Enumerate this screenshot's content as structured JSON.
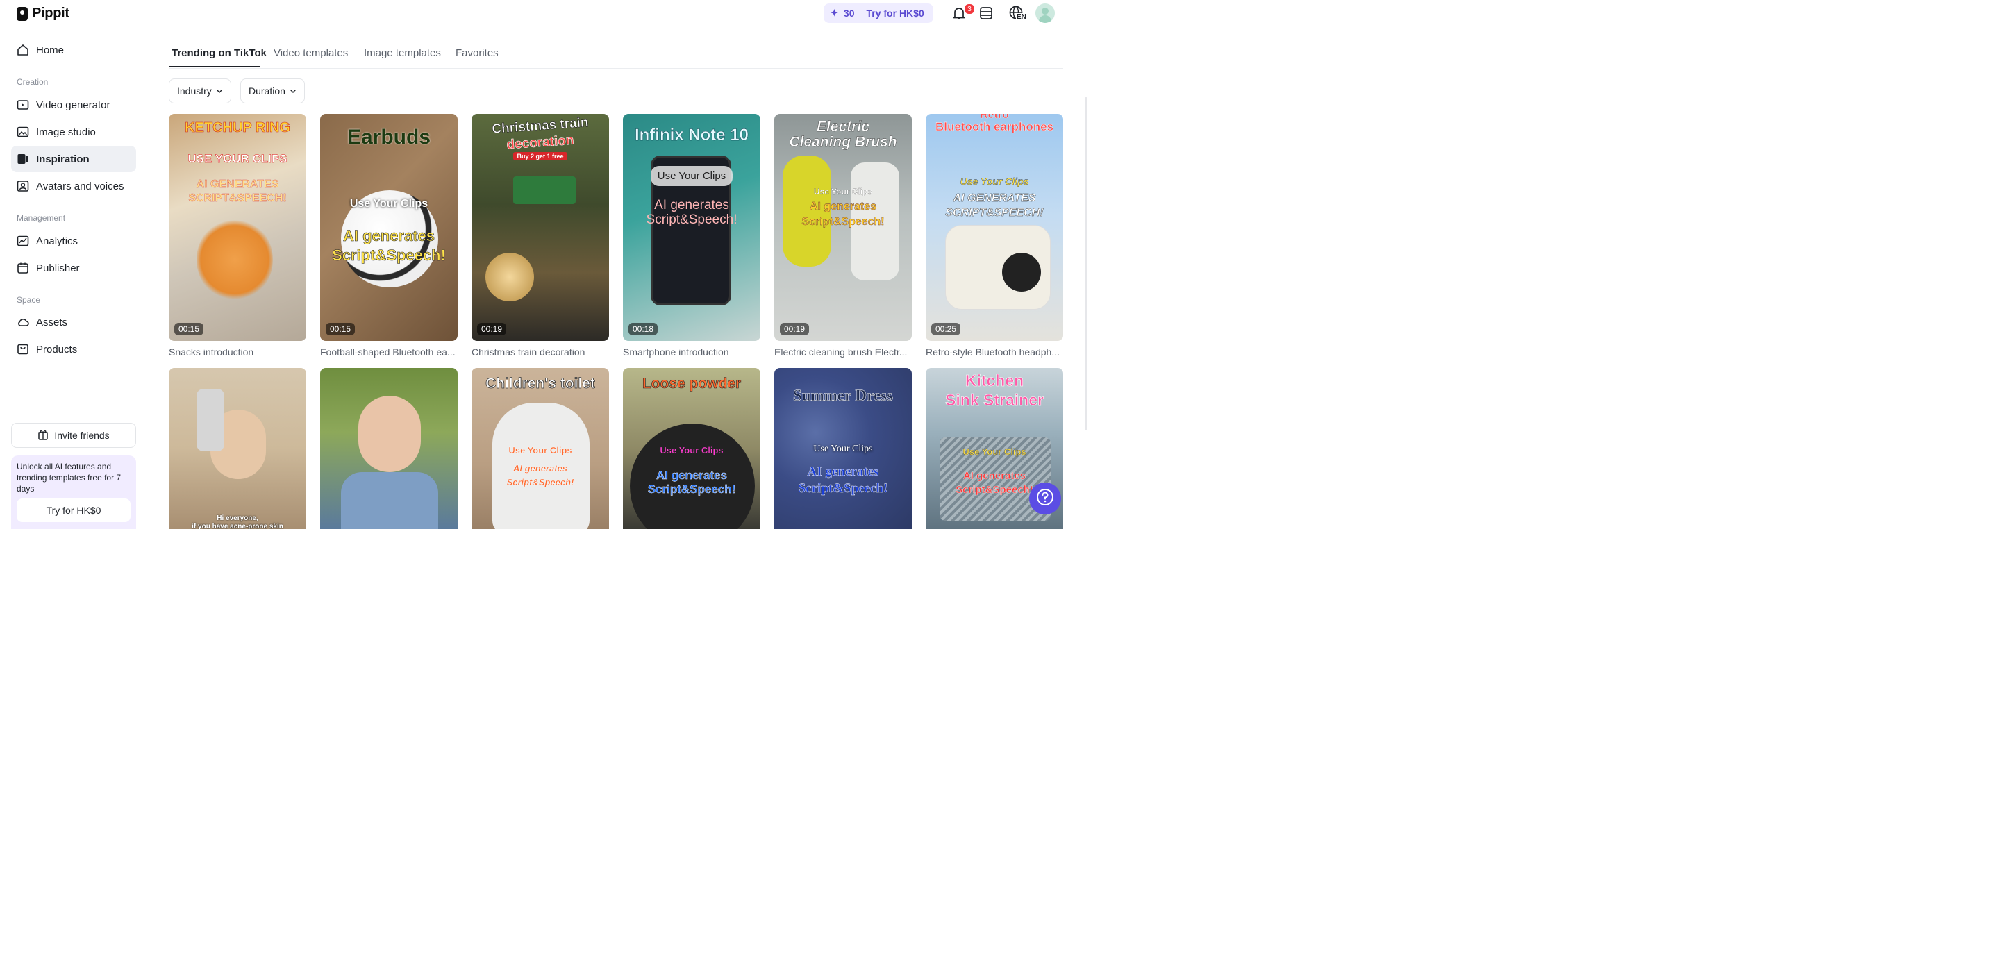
{
  "app": {
    "name": "Pippit"
  },
  "sidebar": {
    "home": "Home",
    "sections": {
      "creation": "Creation",
      "management": "Management",
      "space": "Space"
    },
    "creation_items": [
      "Video generator",
      "Image studio",
      "Inspiration",
      "Avatars and voices"
    ],
    "management_items": [
      "Analytics",
      "Publisher"
    ],
    "space_items": [
      "Assets",
      "Products"
    ],
    "active_item": "Inspiration",
    "invite_label": "Invite friends",
    "promo": {
      "text": "Unlock all AI features and trending templates free for 7 days",
      "button": "Try for HK$0"
    }
  },
  "header": {
    "credits": "30",
    "try_label": "Try for HK$0",
    "notification_count": "3",
    "language": "EN"
  },
  "tabs": [
    "Trending on TikTok",
    "Video templates",
    "Image templates",
    "Favorites"
  ],
  "active_tab": "Trending on TikTok",
  "filters": [
    "Industry",
    "Duration"
  ],
  "row1": [
    {
      "duration": "00:15",
      "caption": "Snacks introduction",
      "overlay": [
        "KETCHUP RING",
        "USE YOUR CLIPS",
        "AI GENERATES",
        "SCRIPT&SPEECH!"
      ]
    },
    {
      "duration": "00:15",
      "caption": "Football-shaped Bluetooth ea...",
      "overlay": [
        "Earbuds",
        "Use Your Clips",
        "AI generates",
        "Script&Speech!"
      ]
    },
    {
      "duration": "00:19",
      "caption": "Christmas train decoration",
      "overlay": [
        "Christmas train",
        "decoration",
        "Buy 2 get 1 free"
      ]
    },
    {
      "duration": "00:18",
      "caption": "Smartphone introduction",
      "overlay": [
        "Infinix Note 10",
        "Use Your Clips",
        "AI generates",
        "Script&Speech!"
      ]
    },
    {
      "duration": "00:19",
      "caption": "Electric cleaning brush Electr...",
      "overlay": [
        "Electric",
        "Cleaning Brush",
        "Use Your Clips",
        "AI generates",
        "Script&Speech!"
      ]
    },
    {
      "duration": "00:25",
      "caption": "Retro-style Bluetooth headph...",
      "overlay": [
        "Retro",
        "Bluetooth earphones",
        "Use Your Clips",
        "AI GENERATES",
        "SCRIPT&SPEECH!"
      ]
    }
  ],
  "row2": [
    {
      "overlay": [
        "Hi everyone,",
        "if you have acne-prone skin"
      ]
    },
    {
      "overlay": []
    },
    {
      "overlay": [
        "Children's toilet",
        "Use Your Clips",
        "AI generates",
        "Script&Speech!"
      ]
    },
    {
      "overlay": [
        "Loose powder",
        "Use Your Clips",
        "AI generates",
        "Script&Speech!"
      ]
    },
    {
      "overlay": [
        "Summer Dress",
        "Use Your Clips",
        "AI generates",
        "Script&Speech!"
      ]
    },
    {
      "overlay": [
        "Kitchen",
        "Sink Strainer",
        "Use Your Clips",
        "AI generates",
        "Script&Speech!"
      ]
    }
  ]
}
